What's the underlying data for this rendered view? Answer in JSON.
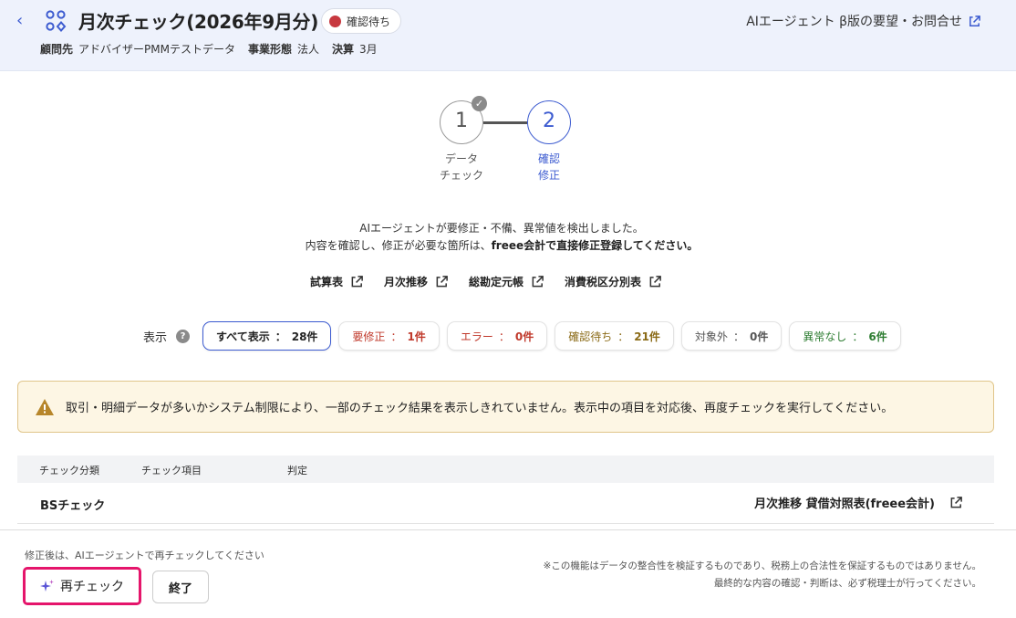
{
  "header": {
    "title": "月次チェック(2026年9月分)",
    "status": "確認待ち",
    "client_label": "顧問先",
    "client_value": "アドバイザーPMMテストデータ",
    "entity_label": "事業形態",
    "entity_value": "法人",
    "fiscal_label": "決算",
    "fiscal_value": "3月",
    "feedback_link": "AIエージェント β版の要望・お問合せ"
  },
  "stepper": {
    "steps": [
      {
        "number": "1",
        "label_line1": "データ",
        "label_line2": "チェック",
        "state": "completed"
      },
      {
        "number": "2",
        "label_line1": "確認",
        "label_line2": "修正",
        "state": "current"
      }
    ]
  },
  "info": {
    "line1": "AIエージェントが要修正・不備、異常値を検出しました。",
    "line2_prefix": "内容を確認し、修正が必要な箇所は、",
    "line2_bold": "freee会計で直接修正登録してください。"
  },
  "links": [
    "試算表",
    "月次推移",
    "総勘定元帳",
    "消費税区分別表"
  ],
  "filter": {
    "label": "表示",
    "chips": [
      {
        "label": "すべて表示",
        "count": "28件"
      },
      {
        "label": "要修正",
        "count": "1件"
      },
      {
        "label": "エラー",
        "count": "0件"
      },
      {
        "label": "確認待ち",
        "count": "21件"
      },
      {
        "label": "対象外",
        "count": "0件"
      },
      {
        "label": "異常なし",
        "count": "6件"
      }
    ],
    "separator": "："
  },
  "warning": "取引・明細データが多いかシステム制限により、一部のチェック結果を表示しきれていません。表示中の項目を対応後、再度チェックを実行してください。",
  "table": {
    "headers": [
      "チェック分類",
      "チェック項目",
      "判定"
    ],
    "rows": [
      {
        "category": "BSチェック",
        "link": "月次推移 貸借対照表(freee会計)"
      }
    ]
  },
  "footer": {
    "hint": "修正後は、AIエージェントで再チェックしてください",
    "recheck_button": "再チェック",
    "end_button": "終了",
    "disclaimer_line1": "※この機能はデータの整合性を検証するものであり、税務上の合法性を保証するものではありません。",
    "disclaimer_line2": "最終的な内容の確認・判断は、必ず税理士が行ってください。"
  },
  "colors": {
    "accent": "#3c5bd0",
    "status_dot": "#c7383f",
    "highlight_border": "#e5156b",
    "warning_bg": "#fdf6e4"
  }
}
